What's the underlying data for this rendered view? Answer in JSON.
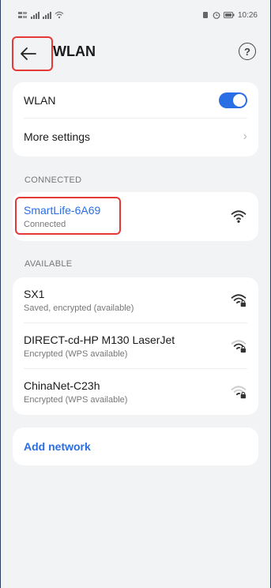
{
  "status_bar": {
    "time": "10:26",
    "left_icons": [
      "sim-icon",
      "signal-icon",
      "signal-icon",
      "wifi-icon"
    ],
    "right_icons": [
      "vibrate-icon",
      "alarm-icon",
      "battery-icon"
    ]
  },
  "header": {
    "title": "WLAN",
    "back_icon": "arrow-left-icon",
    "help_icon": "question-circle-icon",
    "help_glyph": "?"
  },
  "settings": {
    "wlan_label": "WLAN",
    "wlan_enabled": true,
    "more_settings_label": "More settings",
    "chevron_glyph": "›"
  },
  "connected": {
    "section_label": "CONNECTED",
    "network": {
      "ssid": "SmartLife-6A69",
      "status": "Connected"
    }
  },
  "available": {
    "section_label": "AVAILABLE",
    "networks": [
      {
        "ssid": "SX1",
        "status": "Saved, encrypted (available)",
        "locked": true,
        "strength": 3
      },
      {
        "ssid": "DIRECT-cd-HP M130 LaserJet",
        "status": "Encrypted (WPS available)",
        "locked": true,
        "strength": 2
      },
      {
        "ssid": "ChinaNet-C23h",
        "status": "Encrypted (WPS available)",
        "locked": true,
        "strength": 1
      }
    ]
  },
  "add_network": {
    "label": "Add network"
  },
  "colors": {
    "accent": "#2a6ee6",
    "highlight": "#e53935",
    "background": "#f1f3f5"
  }
}
